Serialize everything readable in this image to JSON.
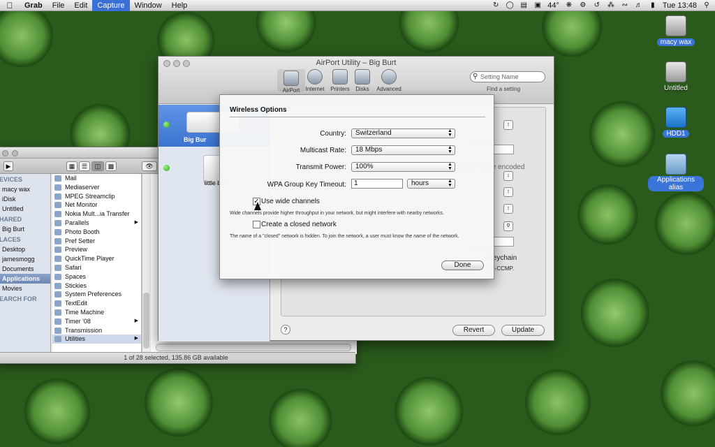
{
  "menubar": {
    "app": "Grab",
    "items": [
      "File",
      "Edit",
      "Capture",
      "Window",
      "Help"
    ],
    "clock": "Tue 13:48",
    "temperature": "44°"
  },
  "desktop": {
    "icons": [
      {
        "label": "macy wax",
        "icon": "hard-drive-icon"
      },
      {
        "label": "Untitled",
        "icon": "hard-drive-icon"
      },
      {
        "label": "HDD1",
        "icon": "wireless-drive-icon"
      },
      {
        "label": "Applications alias",
        "icon": "folder-alias-icon"
      }
    ]
  },
  "finder": {
    "sidebar": {
      "devices_header": "EVICES",
      "devices": [
        "macy wax",
        "iDisk",
        "Untitled"
      ],
      "shared_header": "HARED",
      "shared": [
        "Big Burt"
      ],
      "places_header": "LACES",
      "places": [
        "Desktop",
        "jamesmogg",
        "Documents",
        "Applications",
        "Movies"
      ],
      "search_header": "EARCH FOR"
    },
    "list": [
      "Mail",
      "Mediaserver",
      "MPEG Streamclip",
      "Net Monitor",
      "Nokia Mult...ia Transfer",
      "Parallels",
      "Photo Booth",
      "Pref Setter",
      "Preview",
      "QuickTime Player",
      "Safari",
      "Spaces",
      "Stickies",
      "System Preferences",
      "TextEdit",
      "Time Machine",
      "Timer '08",
      "Transmission",
      "Utilities"
    ],
    "status": "1 of 28 selected, 135.86 GB available"
  },
  "airport": {
    "title": "AirPort Utility – Big Burt",
    "toolbar": [
      "AirPort",
      "Internet",
      "Printers",
      "Disks",
      "Advanced"
    ],
    "search_placeholder": "Setting Name",
    "find_label": "Find a setting",
    "devices": [
      {
        "label": "Big Bur"
      },
      {
        "label": "little bu"
      }
    ],
    "ghost": {
      "encoded": "when this is to be encoded",
      "keychain": "y keychain",
      "ccmp": "ES-CCMP."
    },
    "revert": "Revert",
    "update": "Update",
    "help": "?"
  },
  "sheet": {
    "title": "Wireless Options",
    "country_label": "Country:",
    "country_value": "Switzerland",
    "multicast_label": "Multicast Rate:",
    "multicast_value": "18 Mbps",
    "power_label": "Transmit Power:",
    "power_value": "100%",
    "wpa_label": "WPA Group Key Timeout:",
    "wpa_value": "1",
    "wpa_unit": "hours",
    "wide_label": "Use wide channels",
    "wide_checked": true,
    "wide_desc": "Wide channels provide higher throughput in your network, but might interfere with nearby networks.",
    "closed_label": "Create a closed network",
    "closed_checked": false,
    "closed_desc": "The name of a \"closed\" network is hidden. To join the network, a user must know the name of the network.",
    "done": "Done"
  }
}
